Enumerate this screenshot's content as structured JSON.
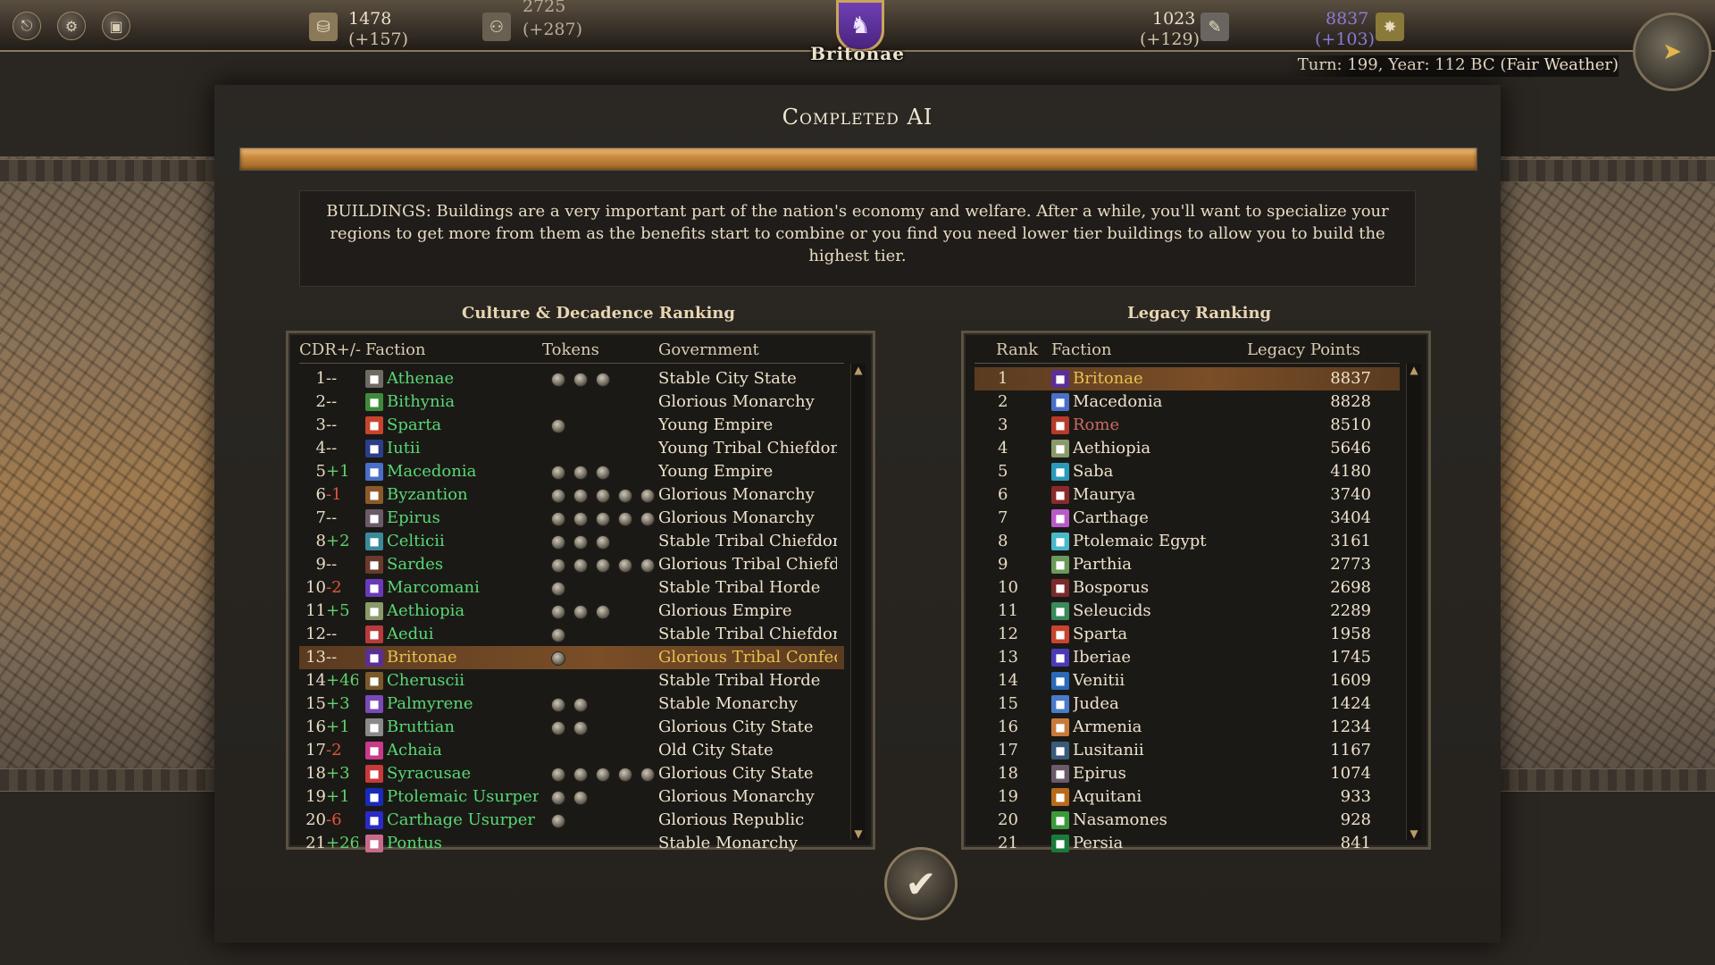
{
  "topbar": {
    "icons": [
      "exit-icon",
      "settings-icon",
      "save-icon"
    ],
    "gold": {
      "value": "1478",
      "delta": "(+157)"
    },
    "population": {
      "value": "2725",
      "delta": "(+287)"
    },
    "faction_emblem": {
      "name": "Britonae",
      "color": "#5b2e97"
    },
    "research": {
      "value": "1023",
      "delta": "(+129)"
    },
    "legacy": {
      "value": "8837",
      "delta": "(+103)",
      "color": "#8a7bd8"
    },
    "turn_info": "Turn: 199, Year: 112 BC (Fair Weather)"
  },
  "dialog": {
    "title": "Completed AI",
    "progress_percent": 100,
    "hint": "BUILDINGS: Buildings are a very important part of the nation's economy and welfare. After a while, you'll want to specialize your regions to get more from them as the benefits start to combine or you find you need lower tier buildings to allow you to build the highest tier."
  },
  "culture_ranking": {
    "title": "Culture & Decadence Ranking",
    "headers": {
      "cdr": "CDR+/-",
      "faction": "Faction",
      "tokens": "Tokens",
      "government": "Government"
    },
    "rows": [
      {
        "rank": "1",
        "delta": "--",
        "faction": "Athenae",
        "tokens": 3,
        "government": "Stable City State",
        "icon": "#6f6a62"
      },
      {
        "rank": "2",
        "delta": "--",
        "faction": "Bithynia",
        "tokens": 0,
        "government": "Glorious Monarchy",
        "icon": "#3e8a3a"
      },
      {
        "rank": "3",
        "delta": "--",
        "faction": "Sparta",
        "tokens": 1,
        "government": "Young Empire",
        "icon": "#c8442e"
      },
      {
        "rank": "4",
        "delta": "--",
        "faction": "Iutii",
        "tokens": 0,
        "government": "Young Tribal Chiefdom",
        "icon": "#2c3e8a"
      },
      {
        "rank": "5",
        "delta": "+1",
        "faction": "Macedonia",
        "tokens": 3,
        "government": "Young Empire",
        "icon": "#4a6fc8"
      },
      {
        "rank": "6",
        "delta": "-1",
        "faction": "Byzantion",
        "tokens": 5,
        "government": "Glorious Monarchy",
        "icon": "#8a5a2a"
      },
      {
        "rank": "7",
        "delta": "--",
        "faction": "Epirus",
        "tokens": 5,
        "government": "Glorious Monarchy",
        "icon": "#6a5a6a"
      },
      {
        "rank": "8",
        "delta": "+2",
        "faction": "Celticii",
        "tokens": 3,
        "government": "Stable Tribal Chiefdom",
        "icon": "#3a8a9a"
      },
      {
        "rank": "9",
        "delta": "--",
        "faction": "Sardes",
        "tokens": 5,
        "government": "Glorious Tribal Chiefdom",
        "icon": "#6a3a2a"
      },
      {
        "rank": "10",
        "delta": "-2",
        "faction": "Marcomani",
        "tokens": 1,
        "government": "Stable Tribal Horde",
        "icon": "#6a3ab8"
      },
      {
        "rank": "11",
        "delta": "+5",
        "faction": "Aethiopia",
        "tokens": 3,
        "government": "Glorious Empire",
        "icon": "#8a9a6a"
      },
      {
        "rank": "12",
        "delta": "--",
        "faction": "Aedui",
        "tokens": 1,
        "government": "Stable Tribal Chiefdom",
        "icon": "#b83a3a"
      },
      {
        "rank": "13",
        "delta": "--",
        "faction": "Britonae",
        "tokens": 1,
        "government": "Glorious Tribal Confederation",
        "icon": "#5b2e97",
        "self": true
      },
      {
        "rank": "14",
        "delta": "+46",
        "faction": "Cheruscii",
        "tokens": 0,
        "government": "Stable Tribal Horde",
        "icon": "#7a5a2a"
      },
      {
        "rank": "15",
        "delta": "+3",
        "faction": "Palmyrene",
        "tokens": 2,
        "government": "Stable Monarchy",
        "icon": "#7a4ab8"
      },
      {
        "rank": "16",
        "delta": "+1",
        "faction": "Bruttian",
        "tokens": 2,
        "government": "Glorious City State",
        "icon": "#8a8a8a"
      },
      {
        "rank": "17",
        "delta": "-2",
        "faction": "Achaia",
        "tokens": 0,
        "government": "Old City State",
        "icon": "#c83a8a"
      },
      {
        "rank": "18",
        "delta": "+3",
        "faction": "Syracusae",
        "tokens": 5,
        "government": "Glorious City State",
        "icon": "#c83a3a"
      },
      {
        "rank": "19",
        "delta": "+1",
        "faction": "Ptolemaic Usurper",
        "tokens": 2,
        "government": "Glorious Monarchy",
        "icon": "#1a2ab8"
      },
      {
        "rank": "20",
        "delta": "-6",
        "faction": "Carthage Usurper",
        "tokens": 1,
        "government": "Glorious Republic",
        "icon": "#2a2ac8"
      },
      {
        "rank": "21",
        "delta": "+26",
        "faction": "Pontus",
        "tokens": 0,
        "government": "Stable Monarchy",
        "icon": "#c86a8a"
      }
    ]
  },
  "legacy_ranking": {
    "title": "Legacy Ranking",
    "headers": {
      "rank": "Rank",
      "faction": "Faction",
      "points": "Legacy Points"
    },
    "rows": [
      {
        "rank": "1",
        "faction": "Britonae",
        "points": "8837",
        "icon": "#5b2e97",
        "self": true
      },
      {
        "rank": "2",
        "faction": "Macedonia",
        "points": "8828",
        "icon": "#4a6fc8"
      },
      {
        "rank": "3",
        "faction": "Rome",
        "points": "8510",
        "icon": "#b83a2a",
        "red": true
      },
      {
        "rank": "4",
        "faction": "Aethiopia",
        "points": "5646",
        "icon": "#8a9a6a"
      },
      {
        "rank": "5",
        "faction": "Saba",
        "points": "4180",
        "icon": "#2a9ab8"
      },
      {
        "rank": "6",
        "faction": "Maurya",
        "points": "3740",
        "icon": "#8a2a2a"
      },
      {
        "rank": "7",
        "faction": "Carthage",
        "points": "3404",
        "icon": "#b85ac8"
      },
      {
        "rank": "8",
        "faction": "Ptolemaic Egypt",
        "points": "3161",
        "icon": "#4ab8c8"
      },
      {
        "rank": "9",
        "faction": "Parthia",
        "points": "2773",
        "icon": "#6a9a5a"
      },
      {
        "rank": "10",
        "faction": "Bosporus",
        "points": "2698",
        "icon": "#7a2a2a"
      },
      {
        "rank": "11",
        "faction": "Seleucids",
        "points": "2289",
        "icon": "#3a8a5a"
      },
      {
        "rank": "12",
        "faction": "Sparta",
        "points": "1958",
        "icon": "#c8442e"
      },
      {
        "rank": "13",
        "faction": "Iberiae",
        "points": "1745",
        "icon": "#4a3ab8"
      },
      {
        "rank": "14",
        "faction": "Venitii",
        "points": "1609",
        "icon": "#2a6ab8"
      },
      {
        "rank": "15",
        "faction": "Judea",
        "points": "1424",
        "icon": "#4a7ac8"
      },
      {
        "rank": "16",
        "faction": "Armenia",
        "points": "1234",
        "icon": "#c87a3a"
      },
      {
        "rank": "17",
        "faction": "Lusitanii",
        "points": "1167",
        "icon": "#3a5a7a"
      },
      {
        "rank": "18",
        "faction": "Epirus",
        "points": "1074",
        "icon": "#6a5a6a"
      },
      {
        "rank": "19",
        "faction": "Aquitani",
        "points": "933",
        "icon": "#b86a1a"
      },
      {
        "rank": "20",
        "faction": "Nasamones",
        "points": "928",
        "icon": "#3a9a3a"
      },
      {
        "rank": "21",
        "faction": "Persia",
        "points": "841",
        "icon": "#1a7a3a"
      }
    ]
  },
  "confirm_icon": "checkmark-icon"
}
